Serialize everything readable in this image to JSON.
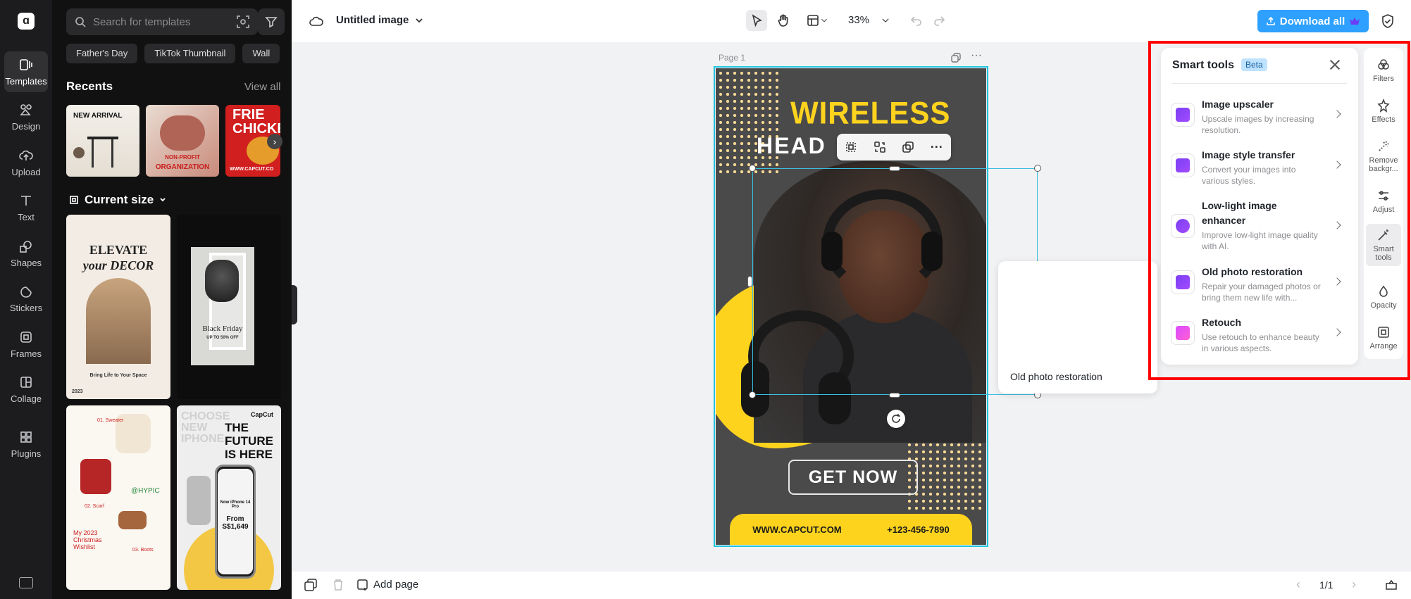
{
  "rail": {
    "items": [
      {
        "label": "Templates",
        "icon": "templates-icon"
      },
      {
        "label": "Design",
        "icon": "design-icon"
      },
      {
        "label": "Upload",
        "icon": "upload-icon"
      },
      {
        "label": "Text",
        "icon": "text-icon"
      },
      {
        "label": "Shapes",
        "icon": "shapes-icon"
      },
      {
        "label": "Stickers",
        "icon": "stickers-icon"
      },
      {
        "label": "Frames",
        "icon": "frames-icon"
      },
      {
        "label": "Collage",
        "icon": "collage-icon"
      },
      {
        "label": "Plugins",
        "icon": "plugins-icon"
      }
    ],
    "active": "Templates"
  },
  "panel": {
    "search_placeholder": "Search for templates",
    "chips": [
      "Father's Day",
      "TikTok Thumbnail",
      "Wall"
    ],
    "recents_title": "Recents",
    "view_all": "View all",
    "recents": [
      {
        "text": "NEW ARRIVAL"
      },
      {
        "text": "ORGANIZATION",
        "subtext": "NON-PROFIT"
      },
      {
        "text": "FRIE CHICKE",
        "subtext": "WWW.CAPCUT.CO"
      }
    ],
    "current_size": "Current size",
    "templates": [
      {
        "title": "ELEVATE",
        "title2": "your DECOR",
        "caption": "Bring Life to Your Space",
        "year": "2023"
      },
      {
        "title": "Black Friday",
        "caption": "UP TO 50% OFF"
      },
      {
        "title": "@HYPIC",
        "caption": "My 2023 Christmas Wishlist",
        "c1": "01. Sweater",
        "c2": "02. Scarf",
        "c3": "03. Boots"
      },
      {
        "title": "THE FUTURE IS HERE",
        "brand": "CapCut",
        "caption": "Now iPhone 14 Pro",
        "price": "From S$1,649",
        "bg": "CHOOSE NEW IPHONE"
      }
    ]
  },
  "topbar": {
    "title": "Untitled image",
    "zoom": "33%",
    "download_label": "Download all"
  },
  "canvas": {
    "page_label": "Page 1",
    "headline1": "WIRELESS",
    "headline2": "HEAD",
    "cta": "GET NOW",
    "website": "WWW.CAPCUT.COM",
    "phone": "+123-456-7890",
    "tooltip": "Old photo restoration"
  },
  "smart_tools": {
    "title": "Smart tools",
    "badge": "Beta",
    "items": [
      {
        "name": "Image upscaler",
        "desc": "Upscale images by increasing resolution."
      },
      {
        "name": "Image style transfer",
        "desc": "Convert your images into various styles."
      },
      {
        "name": "Low-light image enhancer",
        "desc": "Improve low-light image quality with AI."
      },
      {
        "name": "Old photo restoration",
        "desc": "Repair your damaged photos or bring them new life with..."
      },
      {
        "name": "Retouch",
        "desc": "Use retouch to enhance beauty in various aspects."
      }
    ]
  },
  "right_rail": {
    "items": [
      {
        "label": "Filters"
      },
      {
        "label": "Effects"
      },
      {
        "label": "Remove backgr..."
      },
      {
        "label": "Adjust"
      },
      {
        "label": "Smart tools"
      },
      {
        "label": "Opacity"
      },
      {
        "label": "Arrange"
      }
    ]
  },
  "bottombar": {
    "add_page": "Add page",
    "page_count": "1/1"
  },
  "colors": {
    "accent": "#2ea0ff",
    "brand_yellow": "#fdd31e",
    "selection": "#20c4e0",
    "highlight": "#ff0000"
  }
}
